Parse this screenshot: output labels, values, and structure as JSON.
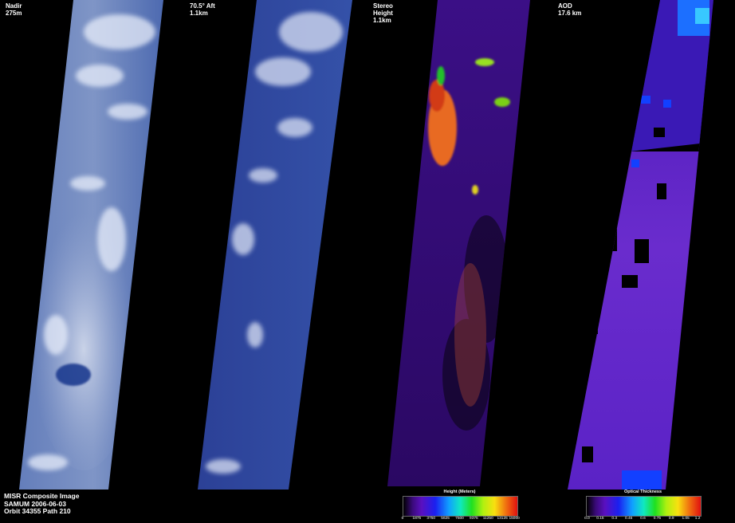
{
  "panels": [
    {
      "label": "Nadir\n275m"
    },
    {
      "label": "70.5° Aft\n1.1km"
    },
    {
      "label": "Stereo\nHeight\n1.1km"
    },
    {
      "label": "AOD\n17.6 km"
    }
  ],
  "info": {
    "line1": "MISR Composite Image",
    "line2": "SAMUM 2006-06-03",
    "line3": "Orbit 34355 Path 210"
  },
  "colorbars": {
    "height": {
      "title": "Height (Meters)",
      "ticks": [
        "0",
        "1875",
        "3750",
        "5625",
        "7500",
        "9375",
        "11250",
        "13125",
        "15000"
      ]
    },
    "aod": {
      "title": "Optical Thickness",
      "ticks": [
        "0.0",
        "0.15",
        "0.3",
        "0.45",
        "0.6",
        "0.75",
        "0.9",
        "1.05",
        "1.2"
      ]
    }
  },
  "colors": {
    "ocean": "#2c4aa0",
    "cloud": "#d0dbef",
    "aod_low": "#5a1fc0",
    "height_low": "#3a0a88"
  }
}
